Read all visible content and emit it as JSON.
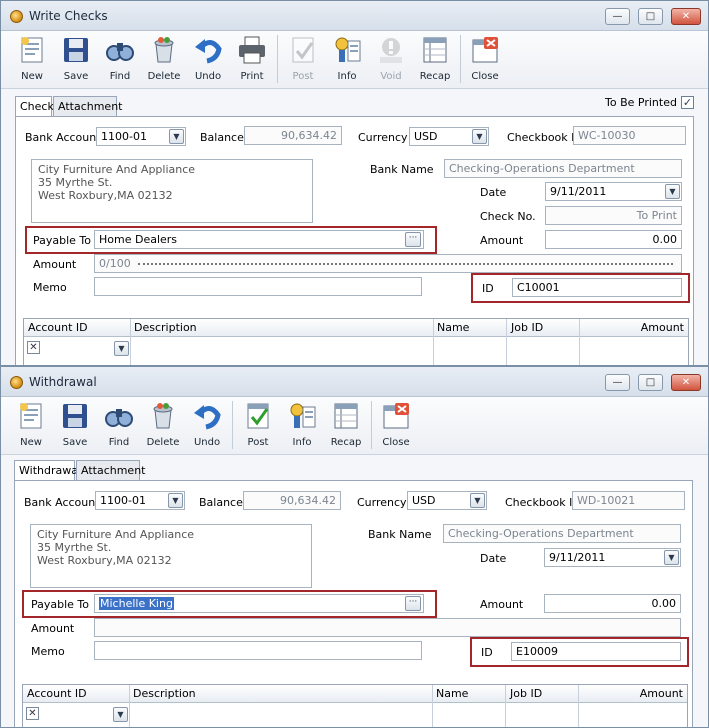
{
  "write_checks": {
    "title": "Write Checks",
    "toolbar": {
      "new": "New",
      "save": "Save",
      "find": "Find",
      "delete": "Delete",
      "undo": "Undo",
      "print": "Print",
      "post": "Post",
      "info": "Info",
      "void": "Void",
      "recap": "Recap",
      "close": "Close"
    },
    "tabs": {
      "check": "Check",
      "attachment": "Attachment"
    },
    "to_be_printed": {
      "label": "To Be Printed",
      "checked": "✓"
    },
    "bank_account": {
      "label": "Bank Account",
      "value": "1100-01"
    },
    "balance": {
      "label": "Balance",
      "value": "90,634.42"
    },
    "currency": {
      "label": "Currency",
      "value": "USD"
    },
    "checkbook_id": {
      "label": "Checkbook ID",
      "value": "WC-10030"
    },
    "address": {
      "line1": "City Furniture And Appliance",
      "line2": "35 Myrthe St.",
      "line3": "West Roxbury,MA 02132"
    },
    "bank_name": {
      "label": "Bank Name",
      "value": "Checking-Operations Department"
    },
    "date": {
      "label": "Date",
      "value": "9/11/2011"
    },
    "check_no": {
      "label": "Check No.",
      "value": "To Print"
    },
    "payable_to": {
      "label": "Payable To",
      "value": "Home Dealers"
    },
    "amount": {
      "label": "Amount",
      "value": "0.00",
      "words_label": "Amount",
      "words_value": "0/100"
    },
    "memo": {
      "label": "Memo",
      "value": ""
    },
    "id": {
      "label": "ID",
      "value": "C10001"
    },
    "grid": {
      "columns": [
        "Account ID",
        "Description",
        "Name",
        "Job ID",
        "Amount"
      ],
      "row_marker": "✕"
    }
  },
  "withdrawal": {
    "title": "Withdrawal",
    "toolbar": {
      "new": "New",
      "save": "Save",
      "find": "Find",
      "delete": "Delete",
      "undo": "Undo",
      "post": "Post",
      "info": "Info",
      "recap": "Recap",
      "close": "Close"
    },
    "tabs": {
      "withdrawal": "Withdrawal",
      "attachment": "Attachment"
    },
    "bank_account": {
      "label": "Bank Account",
      "value": "1100-01"
    },
    "balance": {
      "label": "Balance",
      "value": "90,634.42"
    },
    "currency": {
      "label": "Currency",
      "value": "USD"
    },
    "checkbook_id": {
      "label": "Checkbook ID",
      "value": "WD-10021"
    },
    "address": {
      "line1": "City Furniture And Appliance",
      "line2": "35 Myrthe St.",
      "line3": "West Roxbury,MA 02132"
    },
    "bank_name": {
      "label": "Bank Name",
      "value": "Checking-Operations Department"
    },
    "date": {
      "label": "Date",
      "value": "9/11/2011"
    },
    "payable_to": {
      "label": "Payable To",
      "value": "Michelle King"
    },
    "amount": {
      "label": "Amount",
      "value": "0.00",
      "words_label": "Amount"
    },
    "memo": {
      "label": "Memo",
      "value": ""
    },
    "id": {
      "label": "ID",
      "value": "E10009"
    },
    "grid": {
      "columns": [
        "Account ID",
        "Description",
        "Name",
        "Job ID",
        "Amount"
      ],
      "row_marker": "✕"
    }
  },
  "window_buttons": {
    "minimize": "—",
    "maximize": "□",
    "close": "✕"
  },
  "icons": [
    "new-icon",
    "save-icon",
    "find-icon",
    "delete-icon",
    "undo-icon",
    "print-icon",
    "post-icon",
    "info-icon",
    "void-icon",
    "recap-icon",
    "close-icon"
  ]
}
